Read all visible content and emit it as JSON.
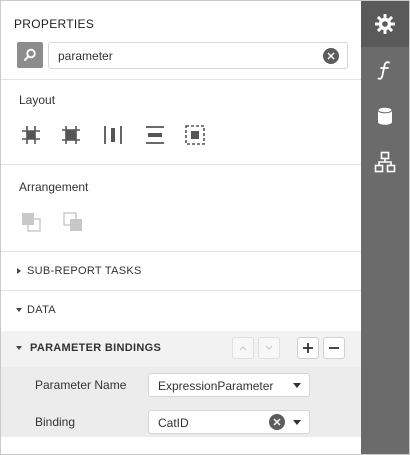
{
  "panel": {
    "title": "PROPERTIES"
  },
  "search": {
    "value": "parameter",
    "icon": "search-icon",
    "clear_icon": "clear-icon"
  },
  "layout": {
    "label": "Layout",
    "tools": [
      {
        "name": "align-to-grid-icon"
      },
      {
        "name": "size-to-grid-icon"
      },
      {
        "name": "center-horizontally-icon"
      },
      {
        "name": "center-vertically-icon"
      },
      {
        "name": "fit-bounds-icon"
      }
    ]
  },
  "arrangement": {
    "label": "Arrangement",
    "tools": [
      {
        "name": "bring-to-front-icon"
      },
      {
        "name": "send-to-back-icon"
      }
    ]
  },
  "groups": {
    "subreport": "SUB-REPORT TASKS",
    "data": "DATA"
  },
  "bindings": {
    "title": "PARAMETER BINDINGS",
    "rows": [
      {
        "label": "Parameter Name",
        "value": "ExpressionParameter"
      },
      {
        "label": "Binding",
        "value": "CatID"
      }
    ]
  },
  "sidebar": {
    "tabs": [
      {
        "name": "properties-tab",
        "icon": "gear-icon"
      },
      {
        "name": "expressions-tab",
        "icon": "function-icon"
      },
      {
        "name": "field-list-tab",
        "icon": "database-icon"
      },
      {
        "name": "report-explorer-tab",
        "icon": "hierarchy-icon"
      }
    ]
  },
  "colors": {
    "sidebar_bg": "#6b6b6b",
    "header_bg": "#f2f2f2",
    "rows_bg": "#ececec"
  }
}
